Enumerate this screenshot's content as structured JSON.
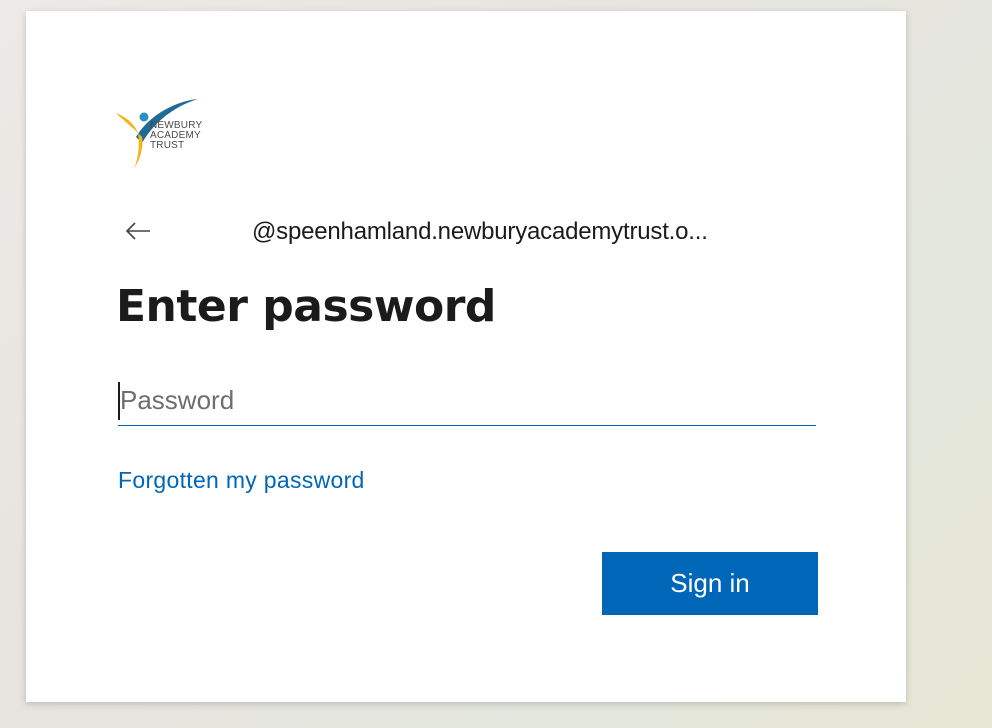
{
  "logo": {
    "lines": [
      "NEWBURY",
      "ACADEMY",
      "TRUST"
    ],
    "colors": {
      "swoosh_blue": "#1f6b95",
      "figure_yellow": "#f2b51e",
      "head_blue": "#2a8fc6"
    }
  },
  "back_button": {
    "icon": "arrow-left-icon"
  },
  "identity": {
    "text": "@speenhamland.newburyacademytrust.o..."
  },
  "title": "Enter password",
  "password_field": {
    "placeholder": "Password",
    "value": ""
  },
  "forgot_link": "Forgotten my password",
  "sign_in_button": "Sign in",
  "colors": {
    "accent": "#0067b8",
    "text": "#1b1b1b",
    "background_card": "#ffffff"
  }
}
